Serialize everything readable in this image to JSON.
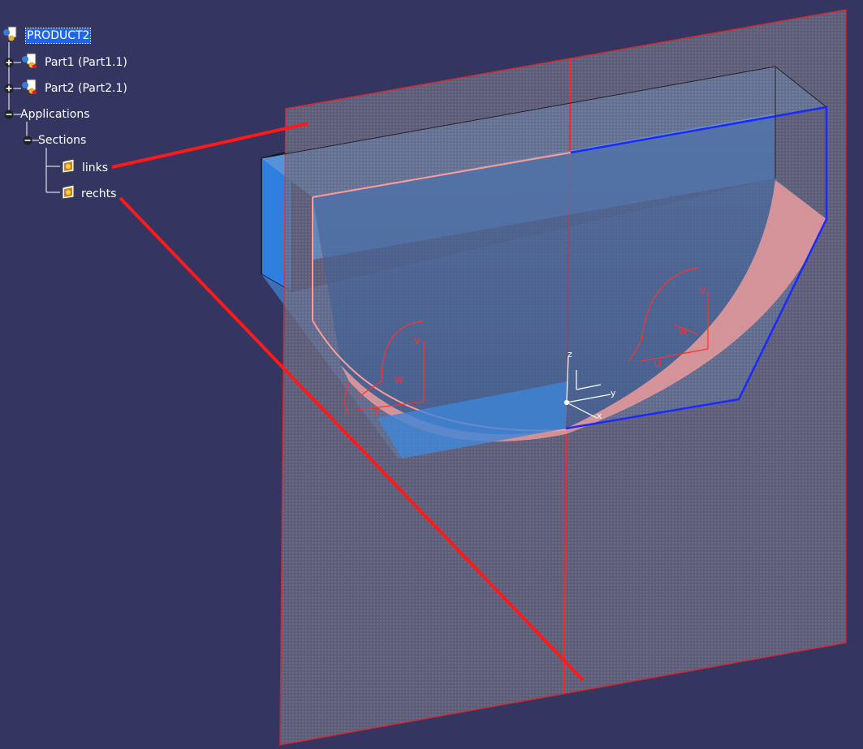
{
  "colors": {
    "background": "#343561",
    "selection": "#1f66e0",
    "section_plane_edge": "#ff2020",
    "solid_blue": "#3a8ee0",
    "cut_face": "#e89090"
  },
  "tree": {
    "root": {
      "label": "PRODUCT2",
      "icon": "product-icon",
      "selected": true
    },
    "part1": {
      "label": "Part1 (Part1.1)",
      "icon": "part-icon",
      "toggle": "+"
    },
    "part2": {
      "label": "Part2 (Part2.1)",
      "icon": "part-icon",
      "toggle": "+"
    },
    "applications": {
      "label": "Applications",
      "toggle": "-"
    },
    "sections": {
      "label": "Sections",
      "toggle": "-"
    },
    "links": {
      "label": "links",
      "icon": "section-icon"
    },
    "rechts": {
      "label": "rechts",
      "icon": "section-icon"
    }
  },
  "axes": {
    "main": {
      "x": "x",
      "y": "y",
      "z": "z"
    },
    "local_left": {
      "u": "U",
      "v": "V",
      "w": "W"
    },
    "local_right": {
      "u": "U",
      "v": "V",
      "w": "W"
    }
  }
}
